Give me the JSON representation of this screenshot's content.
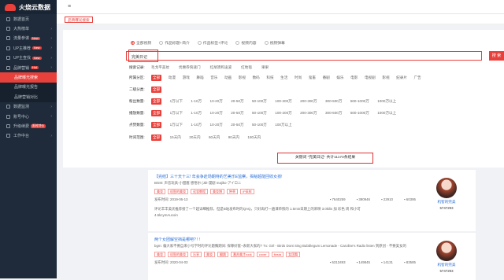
{
  "app": {
    "title": "火烧云数据"
  },
  "sidebar": {
    "items": [
      {
        "label": "数据首页"
      },
      {
        "label": "大热榜单",
        "arrow": "›"
      },
      {
        "label": "流量参谋",
        "badge": "New",
        "arrow": "›"
      },
      {
        "label": "UP主推荐",
        "badge": "New",
        "arrow": "›"
      },
      {
        "label": "UP主查找",
        "badge": "New",
        "arrow": "›"
      },
      {
        "label": "品牌营销",
        "badge": "Hot",
        "arrow": "›"
      }
    ],
    "subitems": [
      {
        "label": "品牌曝光搜索",
        "active": true
      },
      {
        "label": "品牌曝光报告",
        "active": false
      },
      {
        "label": "品牌营销对比",
        "active": false
      }
    ],
    "bottom": [
      {
        "label": "数据监测",
        "arrow": "›"
      },
      {
        "label": "账号中心",
        "arrow": "›"
      },
      {
        "label": "升级续费",
        "badge": "限时特价"
      },
      {
        "label": "工作中台",
        "arrow": "›"
      }
    ]
  },
  "topbar": {
    "menu_icon": "≡"
  },
  "tab": {
    "label": "品牌曝光搜索"
  },
  "search": {
    "radios": [
      "全部视频",
      "作品标题+简介",
      "作品标签+评论",
      "视频内容",
      "视频弹幕"
    ],
    "selected_radio": 0,
    "value": "完美日记",
    "button": "搜 索",
    "history_label": "搜索记录:",
    "history": [
      "毛戈平美妆",
      "优惠券快速门",
      "红胡须和凌波",
      "红地毯",
      "果果"
    ]
  },
  "filters": [
    {
      "label": "所属分区:",
      "options": [
        "全部",
        "动漫",
        "游戏",
        "舞蹈",
        "音乐",
        "动画",
        "影视",
        "数码",
        "科技",
        "生活",
        "时尚",
        "鬼畜",
        "番剧",
        "娱乐",
        "电影",
        "电视剧",
        "影视",
        "纪录片",
        "广告"
      ]
    },
    {
      "label": "二级分类:",
      "options": [
        "全部"
      ]
    },
    {
      "label": "粉丝数量:",
      "options": [
        "全部",
        "1万以下",
        "1-10万",
        "10-20万",
        "20-50万",
        "50-100万",
        "100-200万",
        "200-300万",
        "300-500万",
        "500-1000万",
        "1000万以上"
      ]
    },
    {
      "label": "播放数量:",
      "options": [
        "全部",
        "1万以下",
        "1-10万",
        "10-20万",
        "20-50万",
        "50-100万",
        "100-200万",
        "200-300万",
        "300-500万",
        "500-1000万",
        "1000万以上"
      ]
    },
    {
      "label": "点赞数量:",
      "options": [
        "全部",
        "1万以下",
        "1-10万",
        "10-20万",
        "20-50万",
        "50-100万",
        "100万以上"
      ]
    },
    {
      "label": "时间范围:",
      "options": [
        "全部",
        "15天内",
        "30天内",
        "60天内",
        "90天内",
        "180天内"
      ]
    }
  ],
  "result": {
    "banner": "关键词 \"完美日记\" 共计11173条结果"
  },
  "cards": [
    {
      "title": "【完结】三十天十三! 年会争赴场期待的艺美乐E监察，揭秘超能回收女孩!",
      "bgm": "BGM: 声音玩具-小甜酱 感悟尔 (Jbl-漫剧 majiko-アイロニ",
      "tags": [
        "美妆",
        "机智的美妆",
        "化妆教程",
        "美妆博",
        "种草",
        "IP采样"
      ],
      "date_label": "发布时间: 2019-06-13",
      "stats": [
        "7640259",
        "390946",
        "22910",
        "60395"
      ],
      "desc": "评论丰丰美优推荐接了一个超详细推荐，但是B站发布时的QAQ，只好再打一遍课单照的 1.5min日期上的宋映 3.0kilis 加 彩色 周 和小可",
      "desc2": "4.6kcymAucoin",
      "author": "机智的完美",
      "fans": "5747293"
    },
    {
      "title": "两个女团解空挡是哪吧? ! !",
      "bgm": "bgm: 偏大家不要自来小号学时的评论题胸期间: 探尊好套~表新大家的? Tx: Girl - Birds Dont Sing Bubblegum Lemonade - Caroline's Radio listen 到原创 - 不要美女的 (2*Oral) - Neta 你绑匙好fiesta (快递哦)",
      "tags": [
        "美妆",
        "机智的美妆",
        "乐享",
        "美妆",
        "翻跳",
        "番苏美才rook",
        "cover",
        "fiesta",
        "女团舞"
      ],
      "date_label": "发布时间: 2020-04-03",
      "stats": [
        "5313493",
        "149845",
        "14131",
        "83585"
      ],
      "desc": "",
      "desc2": "",
      "author": "机智的完美",
      "fans": "5747293"
    }
  ],
  "colors": {
    "accent": "#e8413c",
    "sidebar": "#1f2b3a",
    "link": "#2a6fd6"
  },
  "icons": {
    "stats": [
      "play-icon",
      "danmaku-icon",
      "like-icon",
      "coin-icon"
    ]
  }
}
